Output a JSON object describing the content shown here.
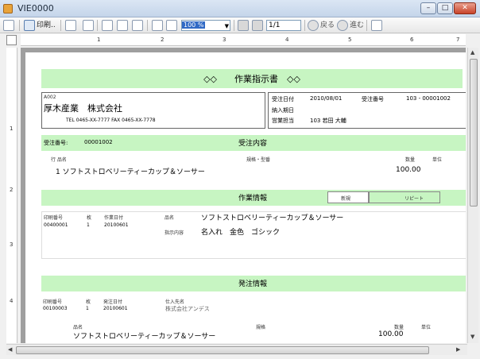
{
  "window": {
    "title": "VIE0000",
    "min": "–",
    "max": "□",
    "close": "✕"
  },
  "toolbar": {
    "print_label": "印刷..",
    "zoom_value": "100 %",
    "page_value": "1/1",
    "back_label": "戻る",
    "forward_label": "進む"
  },
  "ruler": {
    "h_marks": [
      "1",
      "2",
      "3",
      "4",
      "5",
      "6",
      "7"
    ],
    "v_marks": [
      "1",
      "2",
      "3",
      "4"
    ]
  },
  "doc": {
    "title": "◇◇　　作業指示書　◇◇",
    "customer_code": "A002",
    "customer_name": "厚木産業　株式会社",
    "contact": "TEL  0465-XX-7777  FAX 0465-XX-7778",
    "order_date_label": "受注日付",
    "order_date": "2010/08/01",
    "order_no_label": "受注番号",
    "order_no": "103 - 00001002",
    "due_label": "納入期日",
    "sales_label": "営業担当",
    "sales_value": "103  若田 大輔",
    "recv_no_label": "受注番号:",
    "recv_no": "00001002",
    "recv_section": "受注内容",
    "col_line_item": "行 品名",
    "col_spec": "規格・型番",
    "col_qty": "数量",
    "col_unit": "単位",
    "item_line": "1 ソフトストロベリーティーカップ＆ソーサー",
    "item_qty": "100.00",
    "work_section": "作業情報",
    "work_new": "新規",
    "work_repeat": "リピート",
    "work_col_print_no": "印刷番号",
    "work_col_edition": "枚",
    "work_col_date": "作業日付",
    "work_col_product": "品名",
    "work_print_no": "00400001",
    "work_edition": "1",
    "work_date": "20100601",
    "work_product": "ソフトストロベリーティーカップ＆ソーサー",
    "work_detail_label": "指示内容",
    "work_detail": "名入れ　金色　ゴシック",
    "po_section": "発注情報",
    "po_col_print_no": "印刷番号",
    "po_col_edition": "枚",
    "po_col_date": "発注日付",
    "po_col_supplier": "仕入先名",
    "po_print_no": "00100003",
    "po_edition": "1",
    "po_date": "20100601",
    "po_supplier": "株式会社アンデス",
    "po_item_label": "品名",
    "po_spec_label": "規格",
    "po_qty_label": "数量",
    "po_unit_label": "単位",
    "po_item": "ソフトストロベリーティーカップ＆ソーサー",
    "po_qty": "100.00"
  }
}
